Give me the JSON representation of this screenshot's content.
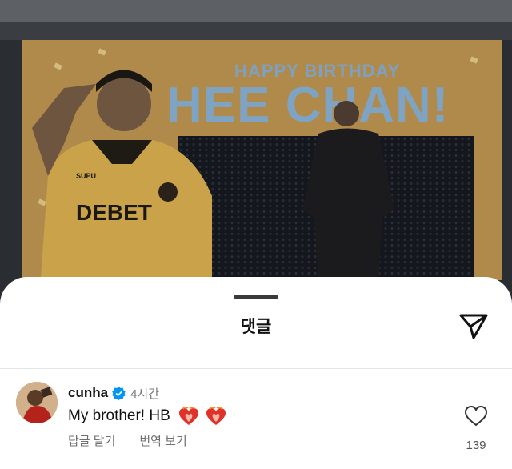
{
  "background": {
    "banner_line1": "HAPPY BIRTHDAY",
    "banner_line2": "HEE CHAN!",
    "shirt_sponsor": "DEBET",
    "shirt_brand": "SUPU"
  },
  "sheet": {
    "title": "댓글"
  },
  "comment": {
    "username": "cunha",
    "verified": true,
    "time": "4시간",
    "text": "My brother! HB",
    "emojis": [
      "heart-on-fire",
      "heart-on-fire"
    ],
    "reply_label": "답글 달기",
    "translate_label": "번역 보기",
    "like_count": "139"
  },
  "colors": {
    "verified_blue": "#0095f6",
    "emoji_red": "#e0322b",
    "emoji_orange": "#f28c28"
  }
}
